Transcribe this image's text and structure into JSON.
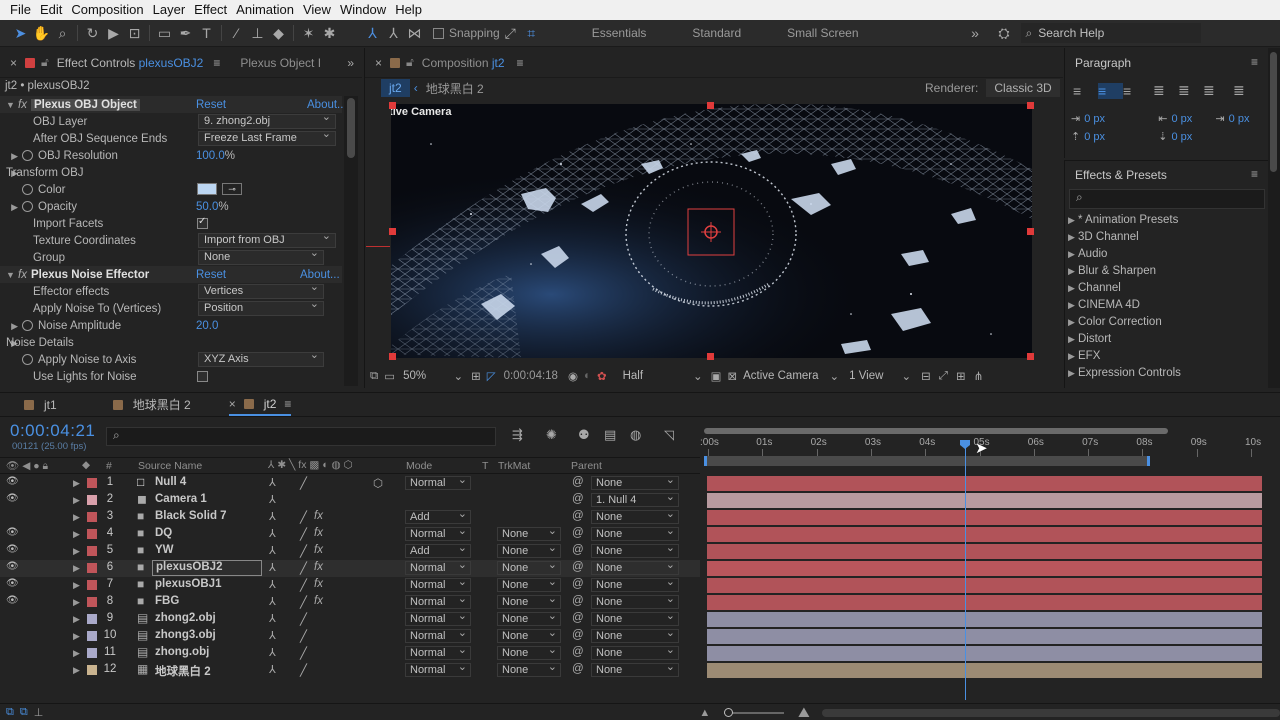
{
  "menu": [
    "File",
    "Edit",
    "Composition",
    "Layer",
    "Effect",
    "Animation",
    "View",
    "Window",
    "Help"
  ],
  "toolbar": {
    "snapping": "Snapping",
    "workspaces": [
      "Essentials",
      "Standard",
      "Small Screen"
    ],
    "search_placeholder": "Search Help"
  },
  "effect_controls": {
    "tab_label": "Effect Controls",
    "tab_target": "plexusOBJ2",
    "tab2": "Plexus Object I",
    "breadcrumb": "jt2 • plexusOBJ2",
    "rows": [
      {
        "label": "Plexus OBJ Object",
        "kind": "fxheader",
        "reset": "Reset",
        "about": "About..."
      },
      {
        "label": "OBJ Layer",
        "kind": "dropdown",
        "value": "9. zhong2.obj"
      },
      {
        "label": "After OBJ Sequence Ends",
        "kind": "dropdown",
        "value": "Freeze Last Frame"
      },
      {
        "label": "OBJ Resolution",
        "kind": "value",
        "value": "100.0",
        "unit": "%"
      },
      {
        "label": "Transform OBJ",
        "kind": "group"
      },
      {
        "label": "Color",
        "kind": "color"
      },
      {
        "label": "Opacity",
        "kind": "value",
        "value": "50.0",
        "unit": "%"
      },
      {
        "label": "Import Facets",
        "kind": "checkbox"
      },
      {
        "label": "Texture Coordinates",
        "kind": "dropdown",
        "value": "Import from OBJ"
      },
      {
        "label": "Group",
        "kind": "dropdown",
        "value": "None"
      },
      {
        "label": "Plexus Noise Effector",
        "kind": "fxheader",
        "reset": "Reset",
        "about": "About..."
      },
      {
        "label": "Effector effects",
        "kind": "dropdown",
        "value": "Vertices"
      },
      {
        "label": "Apply Noise To (Vertices)",
        "kind": "dropdown",
        "value": "Position"
      },
      {
        "label": "Noise Amplitude",
        "kind": "value",
        "value": "20.0",
        "unit": ""
      },
      {
        "label": "Noise Details",
        "kind": "group"
      },
      {
        "label": "Apply Noise to Axis",
        "kind": "dropdown",
        "value": "XYZ Axis"
      },
      {
        "label": "Use Lights for Noise",
        "kind": "checkbox"
      }
    ]
  },
  "composition": {
    "tab_label": "Composition",
    "tab_target": "jt2",
    "crumb_active": "jt2",
    "crumb_prev": "地球黑白 2",
    "renderer_label": "Renderer:",
    "renderer_value": "Classic 3D",
    "active_camera": "Active Camera",
    "footer": {
      "zoom": "50%",
      "timecode": "0:00:04:18",
      "resolution": "Half",
      "view": "Active Camera",
      "views": "1 View"
    }
  },
  "paragraph": {
    "title": "Paragraph",
    "indents": [
      "0 px",
      "0 px",
      "0 px",
      "0 px",
      "0 px"
    ]
  },
  "effects_presets": {
    "title": "Effects & Presets",
    "items": [
      "* Animation Presets",
      "3D Channel",
      "Audio",
      "Blur & Sharpen",
      "Channel",
      "CINEMA 4D",
      "Color Correction",
      "Distort",
      "EFX",
      "Expression Controls"
    ]
  },
  "timeline": {
    "tabs": [
      "jt1",
      "地球黑白 2",
      "jt2"
    ],
    "timecode": "0:00:04:21",
    "frames": "00121 (25.00 fps)",
    "headers": {
      "source": "Source Name",
      "mode": "Mode",
      "t": "T",
      "trkmat": "TrkMat",
      "parent": "Parent"
    },
    "ruler": [
      ":00s",
      "01s",
      "02s",
      "03s",
      "04s",
      "05s",
      "06s",
      "07s",
      "08s",
      "09s",
      "10s"
    ],
    "layers": [
      {
        "num": "1",
        "name": "Null 4",
        "label": "#c0555a",
        "icon": "null",
        "mode": "Normal",
        "trk": "",
        "parent": "None",
        "bar": "#b15359",
        "eye": true
      },
      {
        "num": "2",
        "name": "Camera 1",
        "label": "#d9a0ab",
        "icon": "camera",
        "mode": "",
        "trk": "",
        "parent": "1. Null 4",
        "bar": "#b89a9f",
        "eye": true
      },
      {
        "num": "3",
        "name": "Black Solid 7",
        "label": "#c0555a",
        "icon": "solid",
        "mode": "Add",
        "trk": "",
        "parent": "None",
        "bar": "#b15359",
        "eye": false
      },
      {
        "num": "4",
        "name": "DQ",
        "label": "#c0555a",
        "icon": "solid",
        "mode": "Normal",
        "trk": "None",
        "parent": "None",
        "bar": "#b15359",
        "eye": true
      },
      {
        "num": "5",
        "name": "YW",
        "label": "#c0555a",
        "icon": "solid",
        "mode": "Add",
        "trk": "None",
        "parent": "None",
        "bar": "#b15359",
        "eye": true
      },
      {
        "num": "6",
        "name": "plexusOBJ2",
        "label": "#c0555a",
        "icon": "solid",
        "mode": "Normal",
        "trk": "None",
        "parent": "None",
        "bar": "#b9565c",
        "eye": true
      },
      {
        "num": "7",
        "name": "plexusOBJ1",
        "label": "#c0555a",
        "icon": "solid",
        "mode": "Normal",
        "trk": "None",
        "parent": "None",
        "bar": "#b15359",
        "eye": true
      },
      {
        "num": "8",
        "name": "FBG",
        "label": "#c0555a",
        "icon": "solid",
        "mode": "Normal",
        "trk": "None",
        "parent": "None",
        "bar": "#b15359",
        "eye": true
      },
      {
        "num": "9",
        "name": "zhong2.obj",
        "label": "#a9a9c9",
        "icon": "file",
        "mode": "Normal",
        "trk": "None",
        "parent": "None",
        "bar": "#8e8ea4",
        "eye": false
      },
      {
        "num": "10",
        "name": "zhong3.obj",
        "label": "#a9a9c9",
        "icon": "file",
        "mode": "Normal",
        "trk": "None",
        "parent": "None",
        "bar": "#8e8ea4",
        "eye": false
      },
      {
        "num": "11",
        "name": "zhong.obj",
        "label": "#a9a9c9",
        "icon": "file",
        "mode": "Normal",
        "trk": "None",
        "parent": "None",
        "bar": "#8e8ea4",
        "eye": false
      },
      {
        "num": "12",
        "name": "地球黑白 2",
        "label": "#c9b38f",
        "icon": "comp",
        "mode": "Normal",
        "trk": "None",
        "parent": "None",
        "bar": "#9c8b74",
        "eye": false
      }
    ]
  },
  "colors": {
    "accent": "#4a90e2",
    "playhead": "#4a90e2",
    "layer_red": "#b15359"
  }
}
